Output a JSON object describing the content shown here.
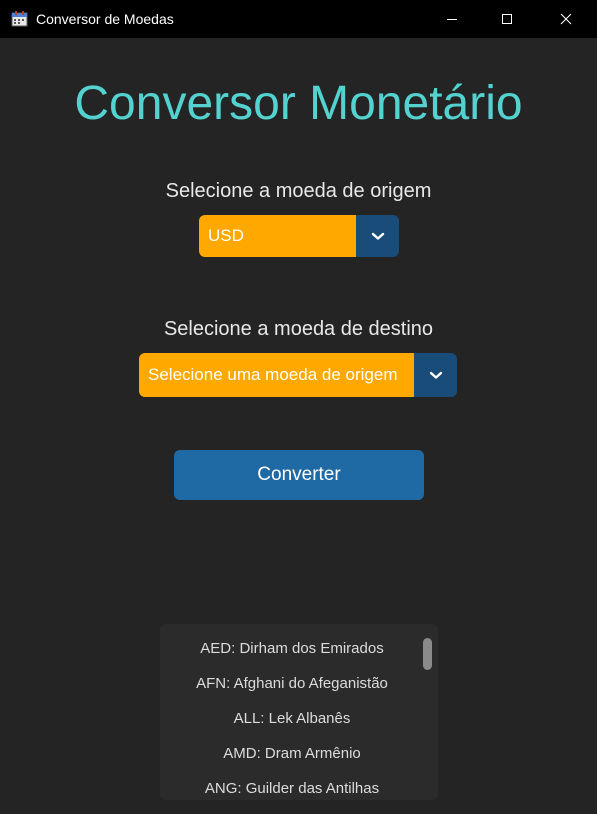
{
  "window": {
    "title": "Conversor de Moedas",
    "icon": "calendar-app-icon"
  },
  "main": {
    "title": "Conversor Monetário",
    "origin_label": "Selecione a moeda de origem",
    "origin_value": "USD",
    "dest_label": "Selecione a moeda de destino",
    "dest_value": "Selecione uma moeda de origem",
    "convert_label": "Converter"
  },
  "currency_list": [
    "AED: Dirham dos Emirados",
    "AFN: Afghani do Afeganistão",
    "ALL: Lek Albanês",
    "AMD: Dram Armênio",
    "ANG: Guilder das Antilhas"
  ],
  "colors": {
    "background": "#242424",
    "title_accent": "#53d2cf",
    "dropdown": "#ffa800",
    "dropdown_arrow": "#1a4c79",
    "button": "#1f6aa5"
  }
}
